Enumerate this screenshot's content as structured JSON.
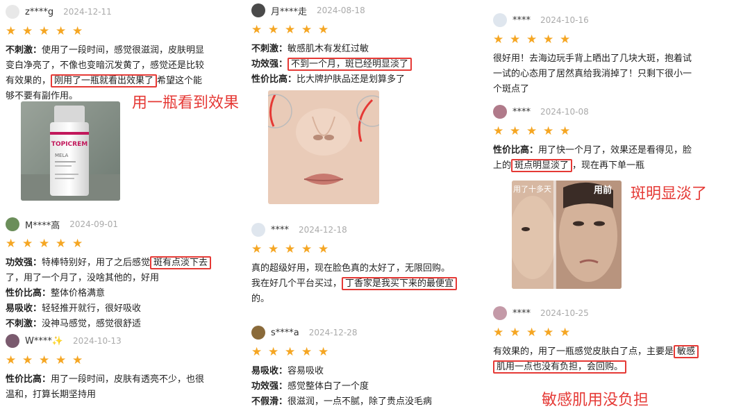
{
  "reviews": [
    {
      "user": "z****g",
      "date": "2024-12-11",
      "avatar_color": "#e8e8e8",
      "segments": [
        {
          "label": "不刺激：",
          "text": "使用了一段时间，感觉很滋润，皮肤明显"
        },
        {
          "text": "变白净亮了，不像也变暗沉发黄了，感觉还是比较"
        },
        {
          "text": "有效果的，",
          "box": "刚用了一瓶就看出效果了",
          "after": "希望这个能"
        },
        {
          "text": "够不要有副作用。"
        }
      ]
    },
    {
      "user": "M****高",
      "date": "2024-09-01",
      "avatar_color": "#6b8e5a",
      "segments": [
        {
          "label": "功效强：",
          "text": "特棒特别好，用了之后感觉",
          "box": "斑有点淡下去"
        },
        {
          "text": "了，用了一个月了，没啥其他的，好用"
        },
        {
          "label": "性价比高：",
          "text": "整体价格满意"
        },
        {
          "label": "易吸收：",
          "text": "轻轻推开就行，很好吸收"
        },
        {
          "label": "不刺激：",
          "text": "没神马感觉，感觉很舒适"
        }
      ]
    },
    {
      "user": "W****✨",
      "date": "2024-10-13",
      "avatar_color": "#7a5a6e",
      "segments": [
        {
          "label": "性价比高：",
          "text": "用了一段时间，皮肤有透亮不少，也很"
        },
        {
          "text": "温和，打算长期坚持用"
        }
      ]
    },
    {
      "user": "月****走",
      "date": "2024-08-18",
      "avatar_color": "#4a4a4a",
      "segments": [
        {
          "label": "不刺激：",
          "text": "敏感肌木有发红过敏"
        },
        {
          "label": "功效强：",
          "text": "",
          "box": "不到一个月，斑已经明显淡了"
        },
        {
          "label": "性价比高：",
          "text": "比大牌护肤品还是划算多了"
        }
      ]
    },
    {
      "user": "****",
      "date": "2024-12-18",
      "avatar_color": "#dfe6ee",
      "segments": [
        {
          "text": "真的超级好用，现在脸色真的太好了，无限回购。"
        },
        {
          "text": "我在好几个平台买过，",
          "box": "丁香家是我买下来的最便宜"
        },
        {
          "text": "的。"
        }
      ]
    },
    {
      "user": "s****a",
      "date": "2024-12-28",
      "avatar_color": "#8a6a3a",
      "segments": [
        {
          "label": "易吸收：",
          "text": "容易吸收"
        },
        {
          "label": "功效强：",
          "text": "感觉整体白了一个度"
        },
        {
          "label": "不假滑：",
          "text": "很滋润，一点不腻，除了贵点没毛病"
        }
      ]
    },
    {
      "user": "****",
      "date": "2024-10-16",
      "avatar_color": "#dfe6ee",
      "segments": [
        {
          "text": "很好用！去海边玩手背上晒出了几块大斑，抱着试"
        },
        {
          "text": "一试的心态用了居然真给我消掉了！只剩下很小一"
        },
        {
          "text": "个斑点了"
        }
      ]
    },
    {
      "user": "****",
      "date": "2024-10-08",
      "avatar_color": "#b07a8a",
      "segments": [
        {
          "label": "性价比高：",
          "text": "用了快一个月了，效果还是看得见，脸"
        },
        {
          "text": "上的",
          "box": "斑点明显淡了",
          "after": "，现在再下单一瓶"
        }
      ]
    },
    {
      "user": "****",
      "date": "2024-10-25",
      "avatar_color": "#c49aa8",
      "segments": [
        {
          "text": "有效果的，用了一瓶感觉皮肤白了点，主要是",
          "box": "敏感"
        },
        {
          "text": "",
          "box": "肌用一点也没有负担，会回购。"
        }
      ]
    }
  ],
  "annotations": {
    "a1": "用一瓶看到效果",
    "a2": "斑明显淡了",
    "a3": "敏感肌用没负担"
  },
  "photos": {
    "product_brand": "TOPICREM",
    "product_line": "MELA",
    "before_label": "用前",
    "after_label": "用了十多天"
  },
  "colors": {
    "star": "#f5a623",
    "highlight": "#e53935",
    "date": "#aaaaaa"
  }
}
